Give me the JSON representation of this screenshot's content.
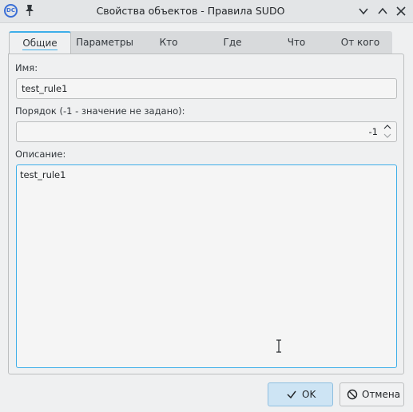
{
  "window": {
    "title": "Свойства объектов - Правила SUDO",
    "app_icon_text": "DC"
  },
  "tabs": [
    {
      "label": "Общие",
      "active": true
    },
    {
      "label": "Параметры",
      "active": false
    },
    {
      "label": "Кто",
      "active": false
    },
    {
      "label": "Где",
      "active": false
    },
    {
      "label": "Что",
      "active": false
    },
    {
      "label": "От кого",
      "active": false
    }
  ],
  "form": {
    "name_label": "Имя:",
    "name_value": "test_rule1",
    "order_label": "Порядок (-1 - значение не задано):",
    "order_value": "-1",
    "description_label": "Описание:",
    "description_value": "test_rule1"
  },
  "buttons": {
    "ok_label": "OK",
    "cancel_label": "Отмена"
  },
  "colors": {
    "accent": "#3daee9",
    "ok_button_bg": "#cde4f4"
  }
}
